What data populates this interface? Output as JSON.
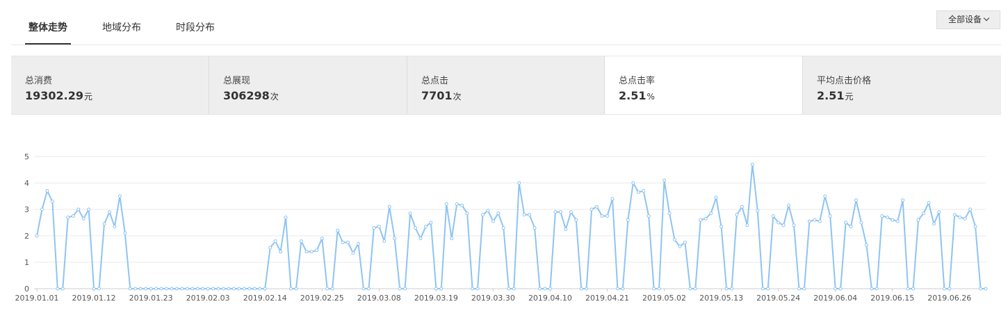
{
  "tabs": [
    {
      "label": "整体走势",
      "active": true
    },
    {
      "label": "地域分布",
      "active": false
    },
    {
      "label": "时段分布",
      "active": false
    }
  ],
  "device_filter": {
    "label": "全部设备",
    "icon": "chevron-down-icon"
  },
  "stats": [
    {
      "label": "总消费",
      "value": "19302.29",
      "unit": "元",
      "active": false
    },
    {
      "label": "总展现",
      "value": "306298",
      "unit": "次",
      "active": false
    },
    {
      "label": "总点击",
      "value": "7701",
      "unit": "次",
      "active": false
    },
    {
      "label": "总点击率",
      "value": "2.51",
      "unit": "%",
      "active": true
    },
    {
      "label": "平均点击价格",
      "value": "2.51",
      "unit": "元",
      "active": false
    }
  ],
  "colors": {
    "line": "#8ec4f2",
    "grid": "#eaeaea",
    "active_tab": "#333333",
    "inactive_stat_bg": "#eeeeee"
  },
  "chart_data": {
    "type": "line",
    "x_tick_labels": [
      "2019.01.01",
      "2019.01.12",
      "2019.01.23",
      "2019.02.03",
      "2019.02.14",
      "2019.02.25",
      "2019.03.08",
      "2019.03.19",
      "2019.03.30",
      "2019.04.10",
      "2019.04.21",
      "2019.05.02",
      "2019.05.13",
      "2019.05.24",
      "2019.06.04",
      "2019.06.15",
      "2019.06.26"
    ],
    "x_start": "2019.01.01",
    "x_end": "2019.06.30",
    "ylim": [
      0,
      5
    ],
    "y_ticks": [
      0,
      1,
      2,
      3,
      4,
      5
    ],
    "grid": true,
    "series": [
      {
        "values": [
          2.0,
          3.0,
          3.7,
          3.3,
          0,
          0,
          2.7,
          2.75,
          3.0,
          2.65,
          3.0,
          0,
          0,
          2.45,
          2.9,
          2.35,
          3.5,
          2.1,
          0,
          0,
          0,
          0,
          0,
          0,
          0,
          0,
          0,
          0,
          0,
          0,
          0,
          0,
          0,
          0,
          0,
          0,
          0,
          0,
          0,
          0,
          0,
          0,
          0,
          0,
          0,
          1.55,
          1.8,
          1.4,
          2.7,
          0,
          0,
          1.8,
          1.4,
          1.4,
          1.45,
          1.9,
          0,
          0,
          2.2,
          1.75,
          1.75,
          1.35,
          1.7,
          0,
          0,
          2.3,
          2.35,
          1.8,
          3.1,
          1.9,
          0,
          0,
          2.85,
          2.3,
          1.9,
          2.35,
          2.5,
          0,
          0,
          3.2,
          1.9,
          3.2,
          3.15,
          2.85,
          0,
          0,
          2.8,
          2.95,
          2.55,
          2.85,
          2.3,
          0,
          0,
          4.0,
          2.8,
          2.8,
          2.3,
          0,
          0,
          0,
          2.9,
          2.9,
          2.25,
          2.9,
          2.6,
          0,
          0,
          3.0,
          3.1,
          2.75,
          2.75,
          3.4,
          0,
          0,
          2.6,
          4.0,
          3.65,
          3.7,
          2.75,
          0,
          0,
          4.1,
          2.85,
          1.85,
          1.6,
          1.75,
          0,
          0,
          2.6,
          2.65,
          2.85,
          3.45,
          2.35,
          0,
          0,
          2.8,
          3.1,
          2.4,
          4.7,
          2.95,
          0,
          0,
          2.75,
          2.5,
          2.4,
          3.15,
          2.4,
          0,
          0,
          2.55,
          2.6,
          2.55,
          3.5,
          2.75,
          0,
          0,
          2.5,
          2.35,
          3.35,
          2.5,
          1.65,
          0,
          0,
          2.75,
          2.7,
          2.6,
          2.55,
          3.35,
          0,
          0,
          2.6,
          2.85,
          3.25,
          2.45,
          2.9,
          0,
          0,
          2.8,
          2.7,
          2.65,
          3.0,
          2.35,
          0,
          0
        ]
      }
    ]
  }
}
